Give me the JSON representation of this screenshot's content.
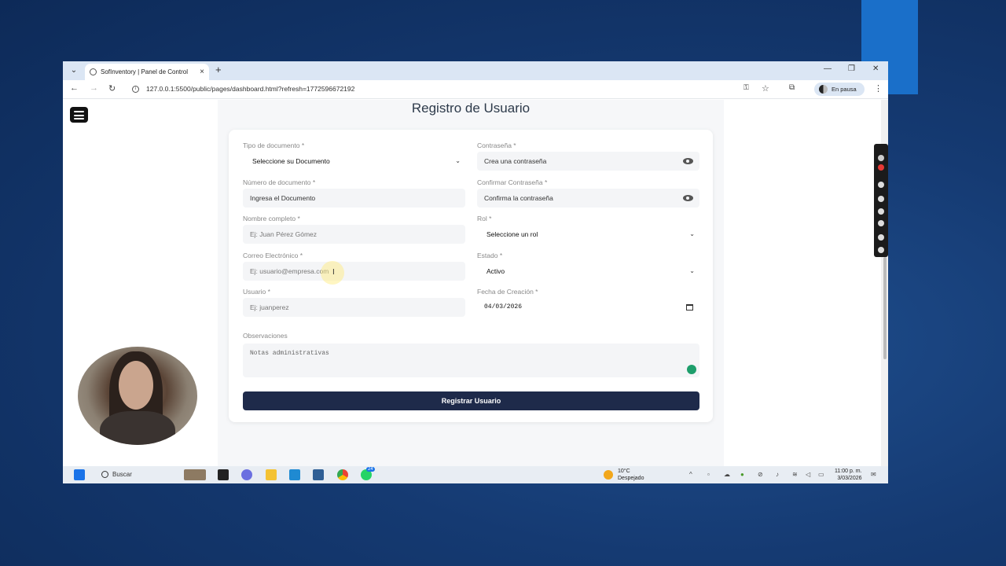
{
  "browser": {
    "tab_title": "SofInventory | Panel de Control",
    "tab_close": "×",
    "new_tab": "+",
    "url": "127.0.0.1:5500/public/pages/dashboard.html?refresh=1772596672192",
    "profile_status": "En pausa",
    "minimize": "—",
    "restore": "❐",
    "close": "✕"
  },
  "page": {
    "title": "Registro de Usuario"
  },
  "form": {
    "tipo_documento": {
      "label": "Tipo de documento *",
      "value": "Seleccione su Documento"
    },
    "contrasena": {
      "label": "Contraseña *",
      "placeholder": "Crea una contraseña"
    },
    "numero_documento": {
      "label": "Número de documento *",
      "placeholder": "Ingresa el Documento"
    },
    "confirmar_contrasena": {
      "label": "Confirmar Contraseña *",
      "placeholder": "Confirma la contraseña"
    },
    "nombre_completo": {
      "label": "Nombre completo *",
      "placeholder": "Ej: Juan Pérez Gómez"
    },
    "rol": {
      "label": "Rol *",
      "value": "Seleccione un rol"
    },
    "correo": {
      "label": "Correo Electrónico *",
      "placeholder": "Ej: usuario@empresa.com"
    },
    "estado": {
      "label": "Estado *",
      "value": "Activo"
    },
    "usuario": {
      "label": "Usuario *",
      "placeholder": "Ej: juanperez"
    },
    "fecha_creacion": {
      "label": "Fecha de Creación *",
      "value": "04/03/2026"
    },
    "observaciones": {
      "label": "Observaciones",
      "placeholder": "Notas administrativas"
    },
    "submit_label": "Registrar Usuario"
  },
  "taskbar": {
    "search_label": "Buscar",
    "weather_temp": "10°C",
    "weather_desc": "Despejado",
    "time": "11:00 p. m.",
    "date": "3/03/2026",
    "whatsapp_badge": "24"
  },
  "colors": {
    "submit_bg": "#1e2a4a",
    "desktop_bg": "#153a72",
    "accent_blue": "#1a6fc9"
  }
}
